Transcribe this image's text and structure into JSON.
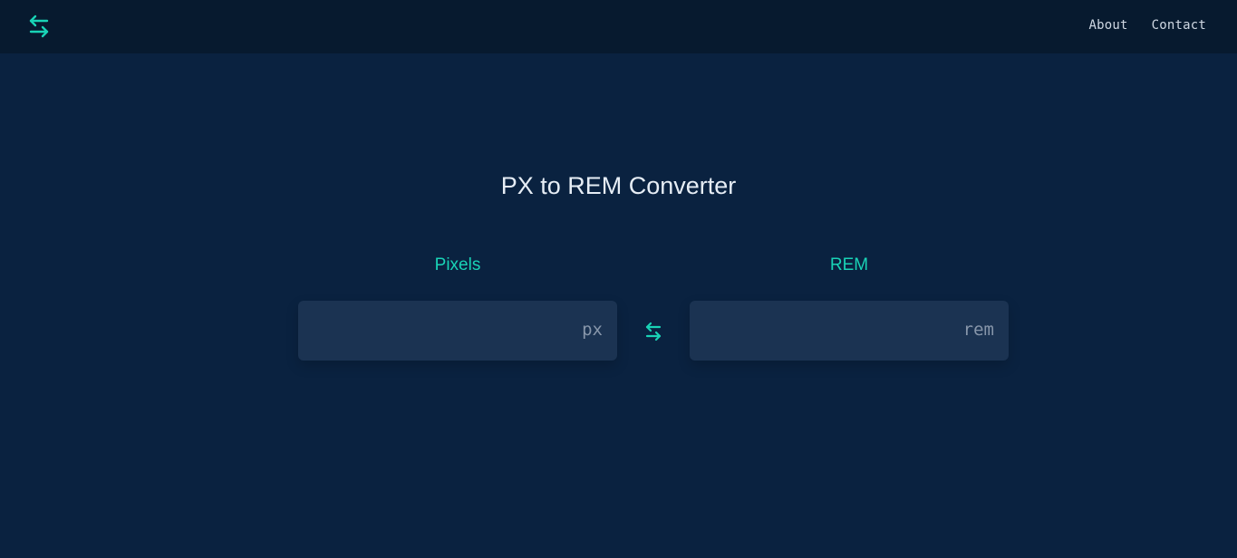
{
  "header": {
    "logo_icon": "swap-arrows-icon",
    "nav": [
      {
        "label": "About"
      },
      {
        "label": "Contact"
      }
    ]
  },
  "main": {
    "title": "PX to REM Converter",
    "pixels": {
      "label": "Pixels",
      "value": "",
      "unit": "px"
    },
    "swap_icon": "swap-arrows-icon",
    "rem": {
      "label": "REM",
      "value": "",
      "unit": "rem"
    }
  },
  "colors": {
    "background": "#0a2240",
    "header_background": "#071a2f",
    "accent": "#19d3b6",
    "field_background": "#1b3352",
    "unit_text": "#8796aa"
  }
}
